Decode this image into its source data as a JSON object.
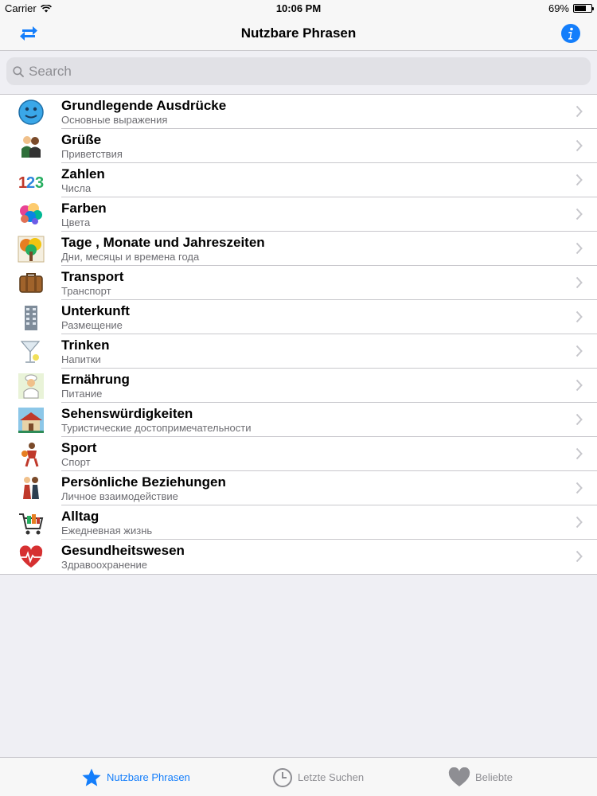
{
  "status_bar": {
    "carrier": "Carrier",
    "time": "10:06 PM",
    "battery": "69%",
    "battery_level": 0.69
  },
  "nav": {
    "title": "Nutzbare Phrasen"
  },
  "search": {
    "placeholder": "Search"
  },
  "categories": [
    {
      "title": "Grundlegende Ausdrücke",
      "subtitle": "Основные выражения",
      "icon": "smiley-face-icon"
    },
    {
      "title": "Grüße",
      "subtitle": "Приветствия",
      "icon": "greeting-people-icon"
    },
    {
      "title": "Zahlen",
      "subtitle": "Числа",
      "icon": "numbers-123-icon",
      "icon_text": "123"
    },
    {
      "title": "Farben",
      "subtitle": "Цвета",
      "icon": "color-splash-icon"
    },
    {
      "title": "Tage , Monate und Jahreszeiten",
      "subtitle": "Дни, месяцы и времена года",
      "icon": "seasons-tree-icon"
    },
    {
      "title": "Transport",
      "subtitle": "Транспорт",
      "icon": "suitcase-icon"
    },
    {
      "title": "Unterkunft",
      "subtitle": "Размещение",
      "icon": "building-icon"
    },
    {
      "title": "Trinken",
      "subtitle": "Напитки",
      "icon": "cocktail-glass-icon"
    },
    {
      "title": "Ernährung",
      "subtitle": "Питание",
      "icon": "chef-icon"
    },
    {
      "title": "Sehenswürdigkeiten",
      "subtitle": "Туристические достопримечательности",
      "icon": "landmark-icon"
    },
    {
      "title": "Sport",
      "subtitle": "Спорт",
      "icon": "basketball-player-icon"
    },
    {
      "title": "Persönliche Beziehungen",
      "subtitle": "Личное взаимодействие",
      "icon": "couple-icon"
    },
    {
      "title": "Alltag",
      "subtitle": "Ежедневная жизнь",
      "icon": "shopping-cart-icon"
    },
    {
      "title": "Gesundheitswesen",
      "subtitle": "Здравоохранение",
      "icon": "heart-pulse-icon"
    }
  ],
  "tabs": [
    {
      "label": "Nutzbare Phrasen",
      "icon": "star-icon",
      "active": true
    },
    {
      "label": "Letzte Suchen",
      "icon": "clock-icon",
      "active": false
    },
    {
      "label": "Beliebte",
      "icon": "heart-icon",
      "active": false
    }
  ],
  "colors": {
    "accent": "#147efb",
    "inactive": "#8e8e93",
    "subtitle": "#6d6d72"
  }
}
